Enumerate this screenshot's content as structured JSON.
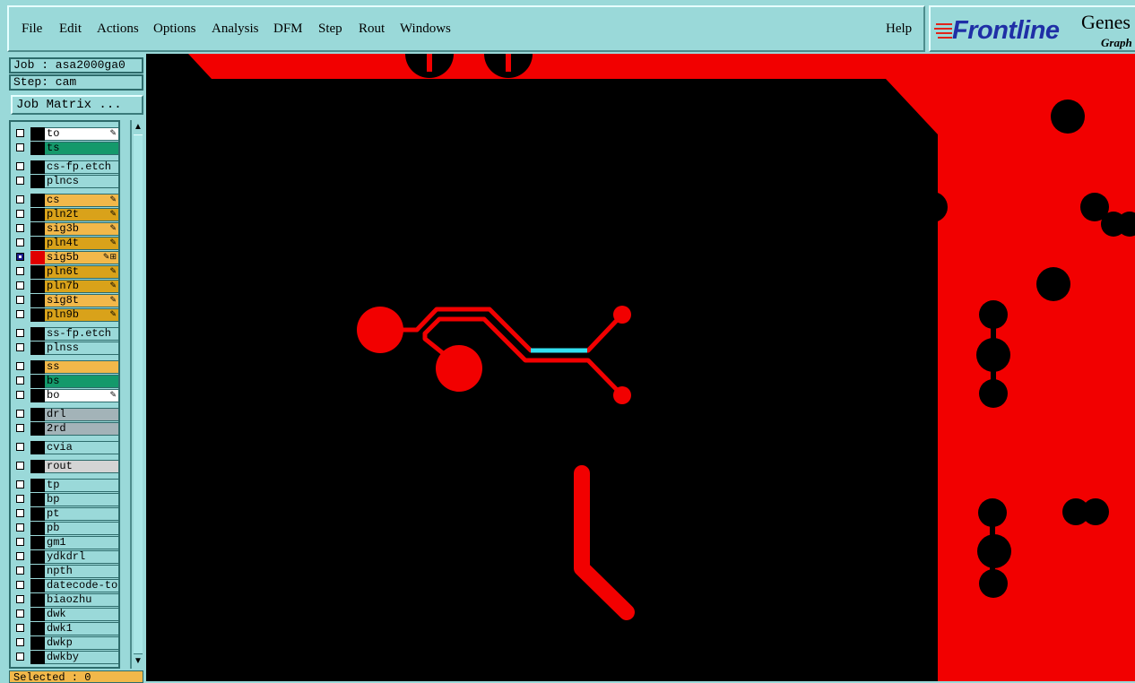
{
  "menu": {
    "file": "File",
    "edit": "Edit",
    "actions": "Actions",
    "options": "Options",
    "analysis": "Analysis",
    "dfm": "DFM",
    "step": "Step",
    "rout": "Rout",
    "windows": "Windows",
    "help": "Help"
  },
  "logo": {
    "brand": "Frontline",
    "product": "Genes",
    "tagline": "Graph"
  },
  "panel": {
    "job": "Job : asa2000ga0",
    "step": "Step: cam",
    "job_matrix": "Job Matrix ...",
    "selected": "Selected : 0"
  },
  "layers": [
    {
      "name": "to",
      "bg": "#ffffff",
      "edit": true
    },
    {
      "name": "ts",
      "bg": "#14996b",
      "edit": false
    },
    {
      "name": "cs-fp.etch",
      "bg": "#9ad9d9",
      "edit": false
    },
    {
      "name": "plncs",
      "bg": "#9ad9d9",
      "edit": false
    },
    {
      "name": "cs",
      "bg": "#f2b84a",
      "edit": true
    },
    {
      "name": "pln2t",
      "bg": "#d9a21a",
      "edit": true
    },
    {
      "name": "sig3b",
      "bg": "#f2b84a",
      "edit": true
    },
    {
      "name": "pln4t",
      "bg": "#d9a21a",
      "edit": true
    },
    {
      "name": "sig5b",
      "bg": "#f2b84a",
      "edit": true,
      "selected": true
    },
    {
      "name": "pln6t",
      "bg": "#d9a21a",
      "edit": true
    },
    {
      "name": "pln7b",
      "bg": "#d9a21a",
      "edit": true
    },
    {
      "name": "sig8t",
      "bg": "#f2b84a",
      "edit": true
    },
    {
      "name": "pln9b",
      "bg": "#d9a21a",
      "edit": true
    },
    {
      "name": "ss-fp.etch",
      "bg": "#9ad9d9",
      "edit": false
    },
    {
      "name": "plnss",
      "bg": "#9ad9d9",
      "edit": false
    },
    {
      "name": "ss",
      "bg": "#f2b84a",
      "edit": false
    },
    {
      "name": "bs",
      "bg": "#14996b",
      "edit": false
    },
    {
      "name": "bo",
      "bg": "#ffffff",
      "edit": true
    },
    {
      "name": "drl",
      "bg": "#a3b3b8",
      "edit": false
    },
    {
      "name": "2rd",
      "bg": "#a3b3b8",
      "edit": false
    },
    {
      "name": "cvia",
      "bg": "#9ad9d9",
      "edit": false
    },
    {
      "name": "rout",
      "bg": "#d4d4d4",
      "edit": false
    },
    {
      "name": "tp",
      "bg": "#9ad9d9",
      "edit": false
    },
    {
      "name": "bp",
      "bg": "#9ad9d9",
      "edit": false
    },
    {
      "name": "pt",
      "bg": "#9ad9d9",
      "edit": false
    },
    {
      "name": "pb",
      "bg": "#9ad9d9",
      "edit": false
    },
    {
      "name": "gm1",
      "bg": "#9ad9d9",
      "edit": false
    },
    {
      "name": "ydkdrl",
      "bg": "#9ad9d9",
      "edit": false
    },
    {
      "name": "npth",
      "bg": "#9ad9d9",
      "edit": false
    },
    {
      "name": "datecode-to",
      "bg": "#9ad9d9",
      "edit": false
    },
    {
      "name": "biaozhu",
      "bg": "#9ad9d9",
      "edit": false
    },
    {
      "name": "dwk",
      "bg": "#9ad9d9",
      "edit": false
    },
    {
      "name": "dwk1",
      "bg": "#9ad9d9",
      "edit": false
    },
    {
      "name": "dwkp",
      "bg": "#9ad9d9",
      "edit": false
    },
    {
      "name": "dwkby",
      "bg": "#9ad9d9",
      "edit": false
    }
  ],
  "colors": {
    "copper": "#f20000",
    "highlight": "#33e0f0",
    "panel": "#9ad9d9"
  },
  "icons": {
    "edit_marker": "pencil-icon",
    "scroll_up": "arrow-up-icon",
    "scroll_down": "arrow-down-icon"
  }
}
